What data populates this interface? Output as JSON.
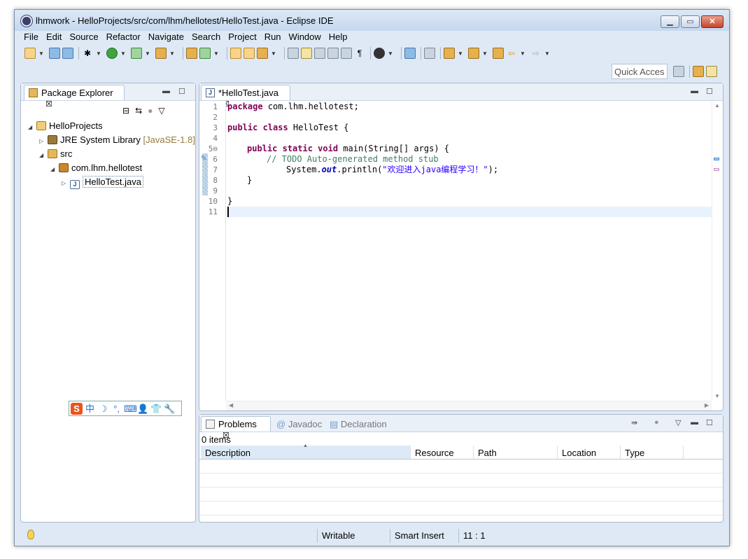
{
  "window": {
    "title": "lhmwork - HelloProjects/src/com/lhm/hellotest/HelloTest.java - Eclipse IDE"
  },
  "menu": [
    "File",
    "Edit",
    "Source",
    "Refactor",
    "Navigate",
    "Search",
    "Project",
    "Run",
    "Window",
    "Help"
  ],
  "quick_access": "Quick Access",
  "package_explorer": {
    "tab_label": "Package Explorer",
    "tree": [
      {
        "label": "HelloProjects",
        "extra": ""
      },
      {
        "label": "JRE System Library",
        "extra": "[JavaSE-1.8]"
      },
      {
        "label": "src",
        "extra": ""
      },
      {
        "label": "com.lhm.hellotest",
        "extra": ""
      },
      {
        "label": "HelloTest.java",
        "extra": ""
      }
    ]
  },
  "editor": {
    "tab_label": "*HelloTest.java",
    "line_numbers": [
      "1",
      "2",
      "3",
      "4",
      "5⊖",
      "6",
      "7",
      "8",
      "9",
      "10",
      "11"
    ],
    "code": {
      "l1_kw": "package",
      "l1_rest": " com.lhm.hellotest;",
      "l3_kw": "public class",
      "l3_rest": " HelloTest {",
      "l5_kw": "public static void",
      "l5_rest": " main(String[] args) {",
      "l6": "// TODO Auto-generated method stub",
      "l7_a": "System.",
      "l7_field": "out",
      "l7_b": ".println(",
      "l7_str": "\"欢迎进入java编程学习！\"",
      "l7_c": ");",
      "l8": "}",
      "l10": "}"
    }
  },
  "problems": {
    "tabs": [
      "Problems",
      "Javadoc",
      "Declaration"
    ],
    "count_text": "0 items",
    "columns": [
      "Description",
      "Resource",
      "Path",
      "Location",
      "Type"
    ]
  },
  "ime": {
    "items": [
      "S",
      "中",
      "☽",
      "°,",
      "⌨",
      "👤",
      "👕",
      "🔧"
    ]
  },
  "status": {
    "writable": "Writable",
    "insert_mode": "Smart Insert",
    "position": "11 : 1"
  }
}
